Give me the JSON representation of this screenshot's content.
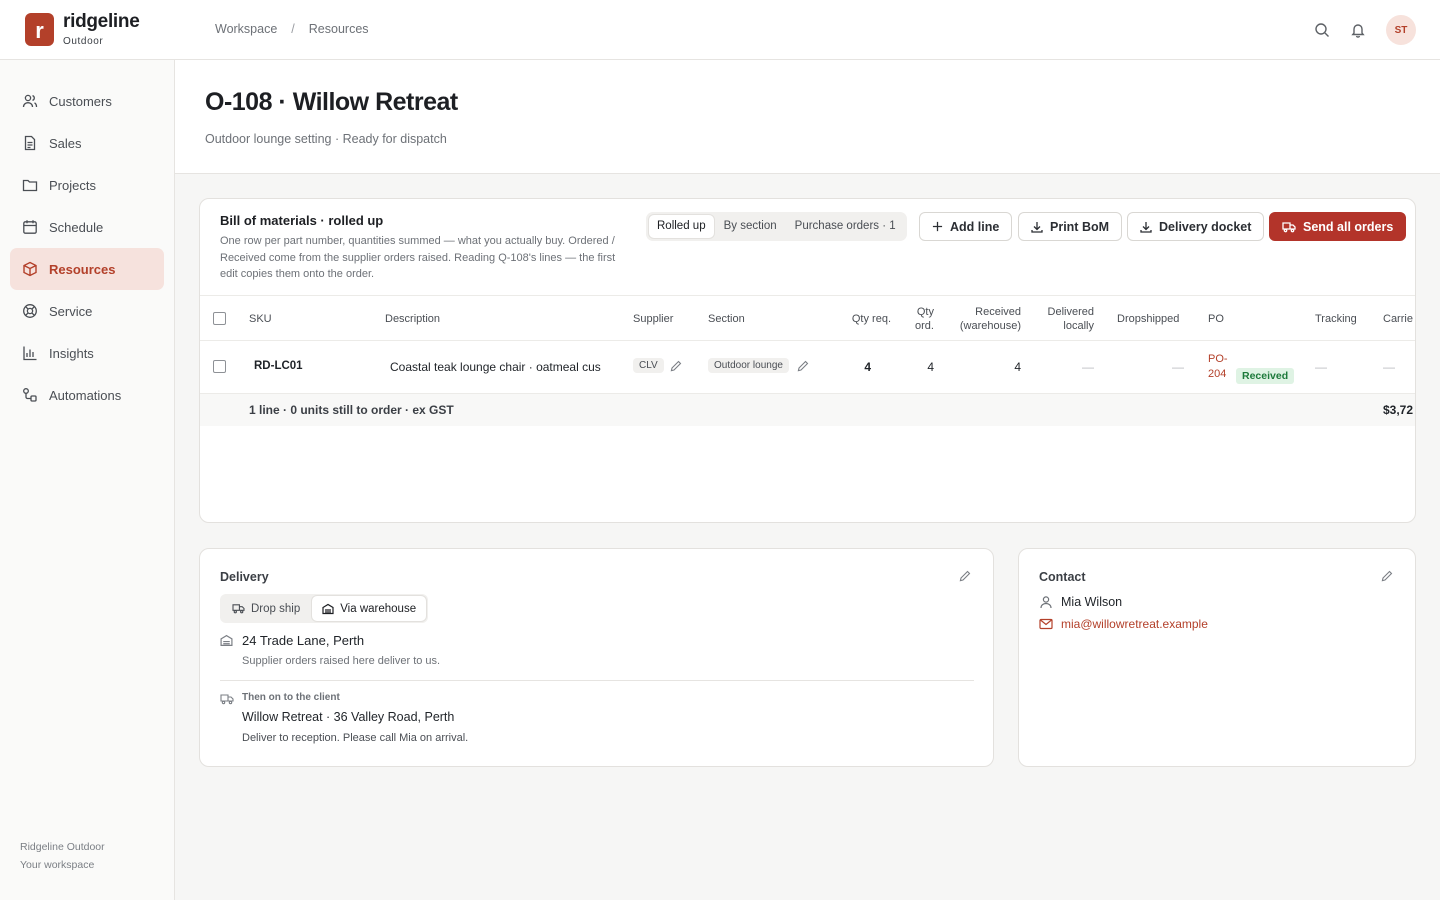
{
  "brand": {
    "name": "ridgeline",
    "sub": "Outdoor",
    "initial": "r"
  },
  "breadcrumb": [
    "Workspace",
    "/",
    "Resources"
  ],
  "user": {
    "initials": "ST"
  },
  "sidebar": {
    "items": [
      {
        "label": "Customers",
        "icon": "users-icon"
      },
      {
        "label": "Sales",
        "icon": "document-icon"
      },
      {
        "label": "Projects",
        "icon": "folder-icon"
      },
      {
        "label": "Schedule",
        "icon": "calendar-icon"
      },
      {
        "label": "Resources",
        "icon": "box-icon",
        "active": true
      },
      {
        "label": "Service",
        "icon": "lifebuoy-icon"
      },
      {
        "label": "Insights",
        "icon": "bar-chart-icon"
      },
      {
        "label": "Automations",
        "icon": "automation-icon"
      }
    ],
    "footer": {
      "company": "Ridgeline Outdoor",
      "workspace": "Your workspace"
    }
  },
  "page": {
    "title": "O-108 · Willow Retreat",
    "subtitle": "Outdoor lounge setting · Ready for dispatch"
  },
  "bom": {
    "title": "Bill of materials · rolled up",
    "description": "One row per part number, quantities summed — what you actually buy. Ordered / Received come from the supplier orders raised. Reading Q-108's lines — the first edit copies them onto the order.",
    "views": [
      "Rolled up",
      "By section",
      "Purchase orders · 1"
    ],
    "active_view": "Rolled up",
    "actions": {
      "add_line": "Add line",
      "print": "Print BoM",
      "docket": "Delivery docket",
      "send": "Send all orders"
    },
    "columns": {
      "sku": "SKU",
      "description": "Description",
      "supplier": "Supplier",
      "section": "Section",
      "qty_req": "Qty req.",
      "qty_ord_1": "Qty",
      "qty_ord_2": "ord.",
      "received_1": "Received",
      "received_2": "(warehouse)",
      "delivered_1": "Delivered",
      "delivered_2": "locally",
      "dropshipped": "Dropshipped",
      "po": "PO",
      "tracking": "Tracking",
      "carrier": "Carrie"
    },
    "rows": [
      {
        "sku": "RD-LC01",
        "description": "Coastal teak lounge chair · oatmeal cus",
        "supplier": "CLV",
        "section": "Outdoor lounge",
        "qty_req": "4",
        "qty_ord": "4",
        "received": "4",
        "delivered": "—",
        "dropshipped": "—",
        "po_1": "PO-",
        "po_2": "204",
        "po_status": "Received",
        "tracking": "—",
        "carrier": "—"
      }
    ],
    "footer": {
      "summary": "1 line · 0 units still to order · ex GST",
      "total": "$3,72"
    }
  },
  "delivery": {
    "label": "Delivery",
    "modes": [
      "Drop ship",
      "Via warehouse"
    ],
    "active_mode": "Via warehouse",
    "warehouse_address": "24 Trade Lane, Perth",
    "warehouse_note": "Supplier orders raised here deliver to us.",
    "then_label": "Then on to the client",
    "client_address": "Willow Retreat · 36 Valley Road, Perth",
    "client_note": "Deliver to reception. Please call Mia on arrival."
  },
  "contact": {
    "label": "Contact",
    "name": "Mia Wilson",
    "email": "mia@willowretreat.example"
  },
  "colors": {
    "accent": "#b3402a",
    "primary_button": "#b3342a",
    "success_bg": "#dff3e4",
    "success_text": "#1d7a3b"
  }
}
